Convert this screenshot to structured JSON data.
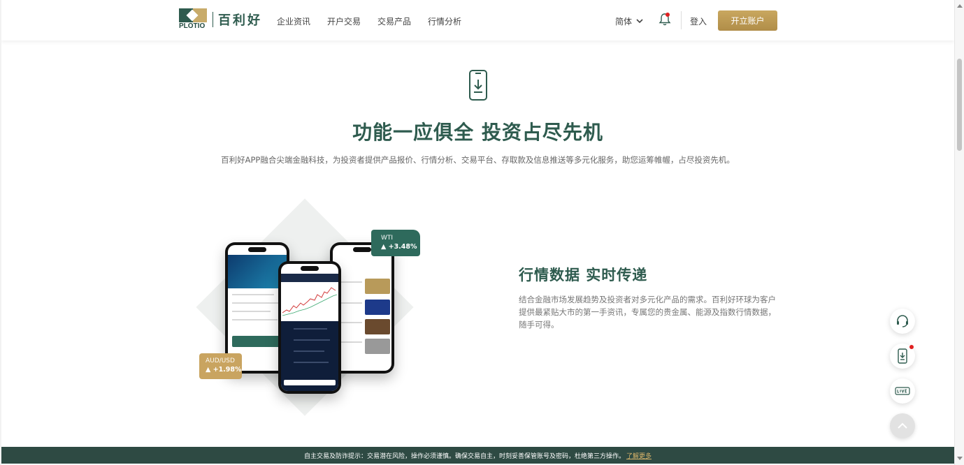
{
  "header": {
    "logo_text": "PLOTIO",
    "brand_name": "百利好",
    "nav": [
      "企业资讯",
      "开户交易",
      "交易产品",
      "行情分析"
    ],
    "language": "简体",
    "login": "登入",
    "open_account": "开立账户"
  },
  "hero": {
    "title": "功能一应俱全 投资占尽先机",
    "subtitle": "百利好APP融合尖端金融科技，为投资者提供产品报价、行情分析、交易平台、存取款及信息推送等多元化服务，助您运筹帷幄，占尽投资先机。"
  },
  "illustration": {
    "badge_wti_name": "WTI",
    "badge_wti_value": "▲ +3.48%",
    "badge_aud_name": "AUD/USD",
    "badge_aud_value": "▲ +1.98%"
  },
  "feature": {
    "title": "行情数据 实时传递",
    "description": "结合金融市场发展趋势及投资者对多元化产品的需求。百利好环球为客户提供最紧贴大市的第一手资讯，专属您的贵金属、能源及指数行情数据，随手可得。"
  },
  "risk_bar": {
    "text": "自主交易及防诈提示：交易潜在风险，操作必须谨慎。确保交易自主，时刻妥善保管账号及密码，杜绝第三方操作。",
    "link": "了解更多"
  },
  "colors": {
    "brand_green": "#2e5b4e",
    "brand_gold": "#c9a75f",
    "risk_bar_bg": "#2e4a43",
    "notification_red": "#e02020"
  },
  "icons": [
    "bell-icon",
    "chevron-down-icon",
    "phone-download-icon",
    "headset-icon",
    "app-download-icon",
    "live-icon",
    "back-to-top-icon"
  ]
}
